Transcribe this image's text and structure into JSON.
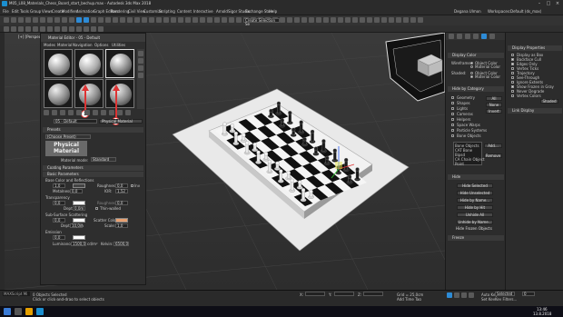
{
  "window": {
    "title": "M05_L08_Materials_Chess_Board_start_bechup.max - Autodesk 3ds Max 2018",
    "sign_in": "Degana Ulmon",
    "workspace": "Workspaces:",
    "workspace_value": "Default (ds_max)",
    "search_hint": "Search"
  },
  "menu": [
    "File",
    "Edit",
    "Tools",
    "Group",
    "Views",
    "Create",
    "Modifiers",
    "Animation",
    "Graph Editors",
    "Rendering",
    "Civil View",
    "Customize",
    "Scripting",
    "Content",
    "Interactive",
    "Arnold",
    "Sigor Studio",
    "Exchange Store",
    "Help"
  ],
  "toolbar": {
    "view_dropdown": "View",
    "create_selection_set": "Create Selection Se",
    "ref_coord": "All"
  },
  "viewport": {
    "label": "[+] [Perspective] [Standard] [Default Shading]"
  },
  "material_editor": {
    "title": "Material Editor - 05 - Default",
    "menu": [
      "Modes",
      "Material",
      "Navigation",
      "Options",
      "Utilities"
    ],
    "material_name": "05 - Default",
    "material_type": "Physical Material",
    "markers": [
      "1",
      "2"
    ],
    "presets": {
      "header": "Presets",
      "dropdown": "(Choose Preset)",
      "physical_label": "Physical\nMaterial",
      "material_mode_label": "Material mode:",
      "material_mode_value": "Standard"
    },
    "coating_header": "Coating Parameters",
    "basic_header": "Basic Parameters",
    "base_color_label": "Base Color and Reflections",
    "base_weight": "1,0",
    "roughness_label": "Roughness:",
    "roughness_value": "0,0",
    "inv_label": "Inv",
    "metalness_label": "Metalness:",
    "metalness_value": "0,0",
    "ior_label": "IOR:",
    "ior_value": "1,52",
    "transparency_label": "Transparency",
    "transp_weight": "0,0",
    "transp_roughness_label": "Roughness:",
    "transp_roughness_value": "0,0",
    "depth_label": "Depth:",
    "depth_value": "0,0m",
    "thin_walled_label": "Thin-walled",
    "sss_label": "Sub-Surface Scattering",
    "sss_weight": "0,0",
    "scatter_color_label": "Scatter Color:",
    "sss_depth_label": "Depth:",
    "sss_depth_value": "10,0m",
    "scale_label": "Scale:",
    "scale_value": "1,0",
    "emission_label": "Emission",
    "emission_weight": "0,0",
    "luminance_label": "Luminance:",
    "luminance_value": "1500,0",
    "luminance_unit": "cd/m²",
    "kelvin_label": "Kelvin:",
    "kelvin_value": "6500,0"
  },
  "command_panel": {
    "display_color_header": "Display Color",
    "wireframe_label": "Wireframe:",
    "wireframe_opts": [
      "Object Color",
      "Material Color"
    ],
    "shaded_label": "Shaded:",
    "shaded_opts": [
      "Object Color",
      "Material Color"
    ],
    "hide_by_category_header": "Hide by Category",
    "categories": [
      "Geometry",
      "Shapes",
      "Lights",
      "Cameras",
      "Helpers",
      "Space Warps",
      "Particle Systems",
      "Bone Objects"
    ],
    "cat_buttons": [
      "All",
      "None",
      "Invert"
    ],
    "list_items": [
      "Bone Objects",
      "CAT Bone",
      "Bipsd",
      "CA Chain Object",
      "Point"
    ],
    "add_button": "Add...",
    "remove_button": "Remove",
    "hide_header": "Hide",
    "hide_buttons": [
      "Hide Selected",
      "Hide Unselected",
      "Hide by Name...",
      "Hide by Hit",
      "Unhide All",
      "Unhide by Name...",
      "Hide Frozen Objects"
    ],
    "freeze_header": "Freeze"
  },
  "display_props": {
    "header": "Display Properties",
    "options": [
      "Display as Box",
      "Backface Cull",
      "Edges Only",
      "Vertex Ticks",
      "Trajectory",
      "See-Through",
      "Ignore Extents",
      "Show Frozen in Gray",
      "Never Degrade",
      "Vertex Colors"
    ],
    "checked": [
      false,
      true,
      true,
      false,
      false,
      false,
      false,
      true,
      false,
      false
    ],
    "shaded_button": "Shaded",
    "link_display_header": "Link Display"
  },
  "status": {
    "objects_selected": "0 Objects Selected",
    "prompt": "Click or click-and-drag to select objects",
    "x_label": "X:",
    "y_label": "Y:",
    "z_label": "Z:",
    "grid": "Grid = 25,0cm",
    "add_time_tag": "Add Time Tag",
    "autokey": "Auto Key",
    "selected": "Selected",
    "set_key": "Set Key",
    "key_filters": "Key Filters...",
    "frame": "0",
    "time": "13:46",
    "date": "13.8.2018",
    "maxscript": "MAXScript Mi"
  },
  "colors": {
    "accent": "#2d8bd6",
    "marker_red": "#d33333",
    "scatter_swatch": "#e8a070"
  }
}
